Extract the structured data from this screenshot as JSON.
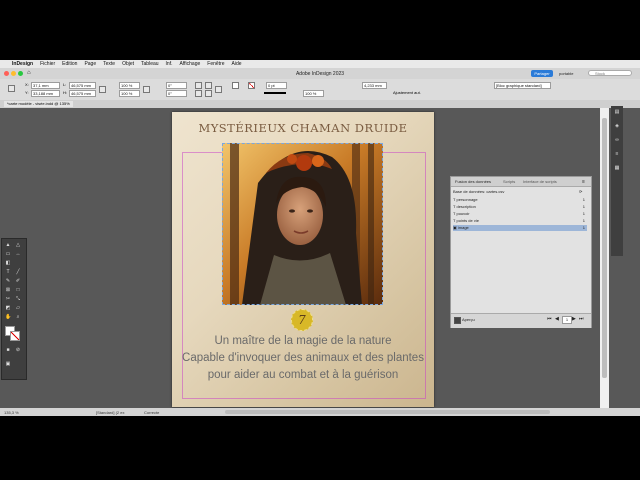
{
  "menubar": {
    "app": "InDesign",
    "items": [
      "Fichier",
      "Edition",
      "Page",
      "Texte",
      "Objet",
      "Tableau",
      "Inf.",
      "Affichage",
      "Fenêtre",
      "Aide"
    ]
  },
  "window": {
    "title": "Adobe InDesign 2023",
    "share_button": "Partager",
    "workspace": "portable",
    "search_placeholder": "Stock"
  },
  "control": {
    "x": "37,1 mm",
    "y": "33,188 mm",
    "w": "46,575 mm",
    "h": "46,575 mm",
    "scale_x": "100 %",
    "scale_y": "100 %",
    "angle": "0°",
    "shear": "0°",
    "stroke": "0 pt",
    "opacity": "100 %",
    "offset": "4,233 mm",
    "autofit": "Ajustement aut.",
    "style": "[Bloc graphique standard]"
  },
  "document_tab": {
    "label": "*carte modèle - visée.indd @ 135%"
  },
  "card": {
    "title": "MYSTÉRIEUX CHAMAN DRUIDE",
    "power": "7",
    "description": [
      "Un maître de la magie de la nature",
      "Capable d'invoquer des animaux et des plantes",
      "pour aider au combat et à la guérison"
    ]
  },
  "panel": {
    "tabs": [
      "Fusion des données",
      "Scripts",
      "Interface de scripts"
    ],
    "source": "Base de données: cartes.csv",
    "fields": [
      {
        "name": "personnage",
        "value": "1"
      },
      {
        "name": "description",
        "value": "1"
      },
      {
        "name": "pouvoir",
        "value": "1"
      },
      {
        "name": "points de vie",
        "value": "1"
      },
      {
        "name": "image",
        "value": "1"
      }
    ],
    "selected_field": "image",
    "preview_label": "Aperçu",
    "record": "1"
  },
  "status": {
    "zoom": "135,3 %",
    "page_style": "[Standard] (2 ex",
    "preflight": "Correcte"
  }
}
